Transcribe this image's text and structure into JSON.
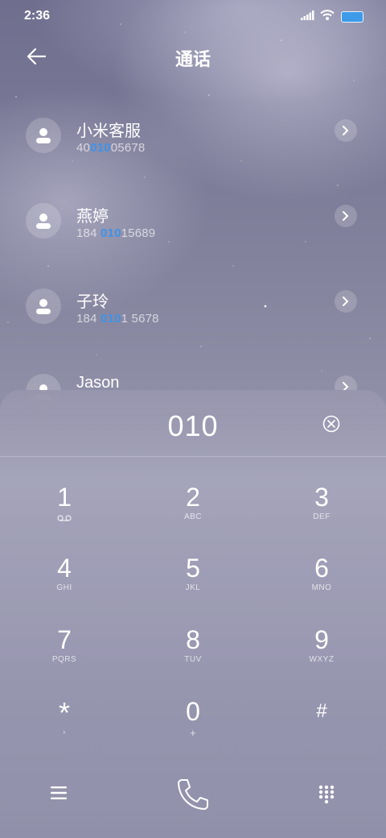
{
  "status": {
    "time": "2:36"
  },
  "header": {
    "title": "通话"
  },
  "contacts": [
    {
      "name": "小米客服",
      "num_pre": "40",
      "num_hl": "010",
      "num_post": "05678"
    },
    {
      "name": "燕婷",
      "num_pre": "184 ",
      "num_hl": "010",
      "num_post": "15689"
    },
    {
      "name": "子玲",
      "num_pre": "184 ",
      "num_hl": "010",
      "num_post": "1 5678"
    },
    {
      "name": "Jason",
      "num_pre": "",
      "num_hl": "",
      "num_post": ""
    }
  ],
  "dialer": {
    "number": "010",
    "keys": [
      {
        "digit": "1",
        "letters": ""
      },
      {
        "digit": "2",
        "letters": "ABC"
      },
      {
        "digit": "3",
        "letters": "DEF"
      },
      {
        "digit": "4",
        "letters": "GHI"
      },
      {
        "digit": "5",
        "letters": "JKL"
      },
      {
        "digit": "6",
        "letters": "MNO"
      },
      {
        "digit": "7",
        "letters": "PQRS"
      },
      {
        "digit": "8",
        "letters": "TUV"
      },
      {
        "digit": "9",
        "letters": "WXYZ"
      },
      {
        "digit": "*",
        "letters": ","
      },
      {
        "digit": "0",
        "letters": "+"
      },
      {
        "digit": "#",
        "letters": ""
      }
    ]
  },
  "icons": {
    "back": "back-arrow-icon",
    "avatar": "person-icon",
    "chevron": "chevron-right-icon",
    "clear": "clear-circle-x-icon",
    "voicemail": "voicemail-icon",
    "menu": "menu-icon",
    "call": "phone-icon",
    "keypad": "keypad-icon"
  },
  "colors": {
    "highlight": "#3d93e9",
    "battery": "#3d9be9"
  }
}
